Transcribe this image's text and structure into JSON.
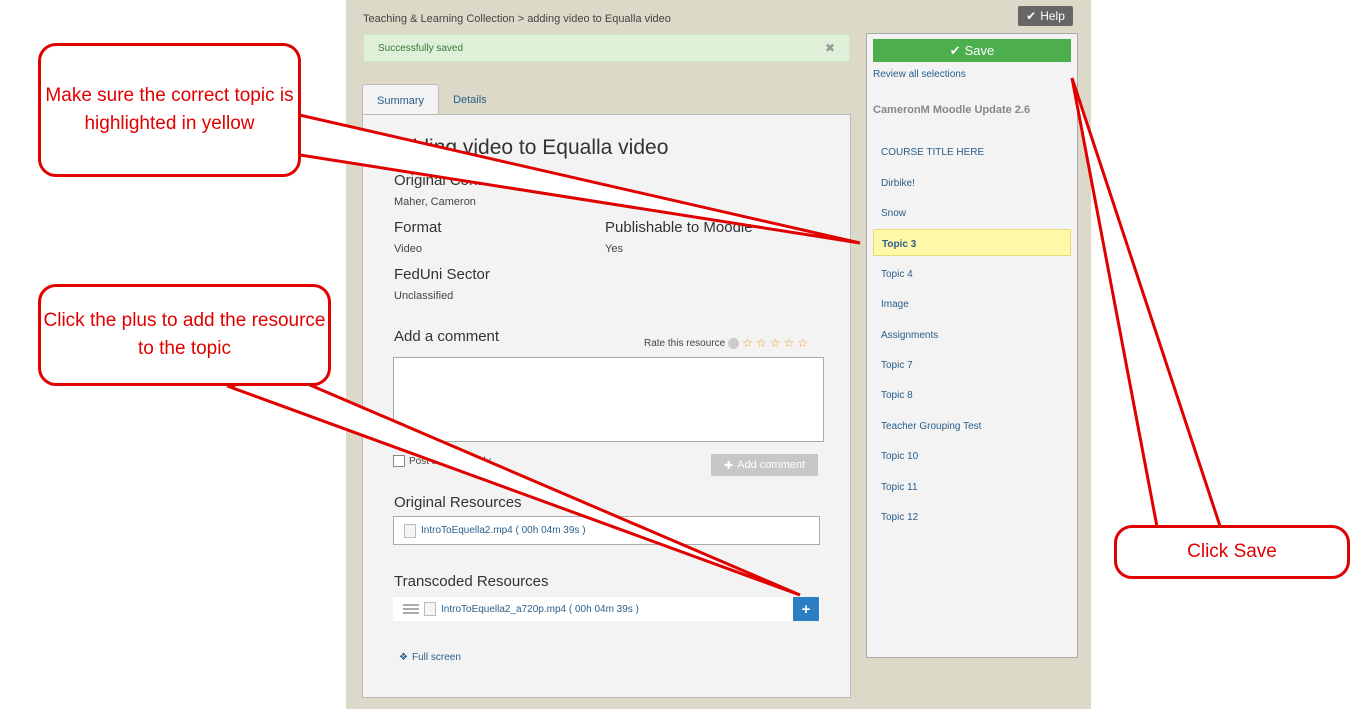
{
  "breadcrumb": "Teaching & Learning Collection > adding video to Equalla video",
  "help_label": "Help",
  "alert": {
    "text": "Successfully saved",
    "close": "✖"
  },
  "tabs": [
    "Summary",
    "Details"
  ],
  "item": {
    "title": "adding video to Equalla video",
    "original_contributor_label": "Original Contributor",
    "original_contributor_value": "Maher, Cameron",
    "format_label": "Format",
    "format_value": "Video",
    "publishable_label": "Publishable to Moodle",
    "publishable_value": "Yes",
    "sector_label": "FedUni Sector",
    "sector_value": "Unclassified"
  },
  "comment": {
    "heading": "Add a comment",
    "rate_label": "Rate this resource",
    "anon_label": "Post anonymously",
    "add_button": "Add comment"
  },
  "original_resources": {
    "heading": "Original Resources",
    "file": "IntroToEquella2.mp4 ( 00h 04m 39s )"
  },
  "transcoded_resources": {
    "heading": "Transcoded Resources",
    "file": "IntroToEquella2_a720p.mp4 ( 00h 04m 39s )"
  },
  "full_screen": "Full screen",
  "sidebar": {
    "save_label": "Save",
    "review_label": "Review all selections",
    "course_title": "CameronM Moodle Update 2.6",
    "topics": [
      "COURSE TITLE HERE",
      "Dirbike!",
      "Snow",
      "Topic 3",
      "Topic 4",
      "Image",
      "Assignments",
      "Topic 7",
      "Topic 8",
      "Teacher Grouping Test",
      "Topic 10",
      "Topic 11",
      "Topic 12"
    ],
    "selected_topic": "Topic 3"
  },
  "callouts": {
    "topic": "Make sure the correct topic is highlighted in yellow",
    "plus": "Click the plus to add the resource to the topic",
    "save": "Click Save"
  },
  "colors": {
    "accent_red": "#e00000",
    "save_green": "#4cae4c",
    "plus_blue": "#2d7fc4",
    "highlight_yellow": "#fef9a7"
  }
}
